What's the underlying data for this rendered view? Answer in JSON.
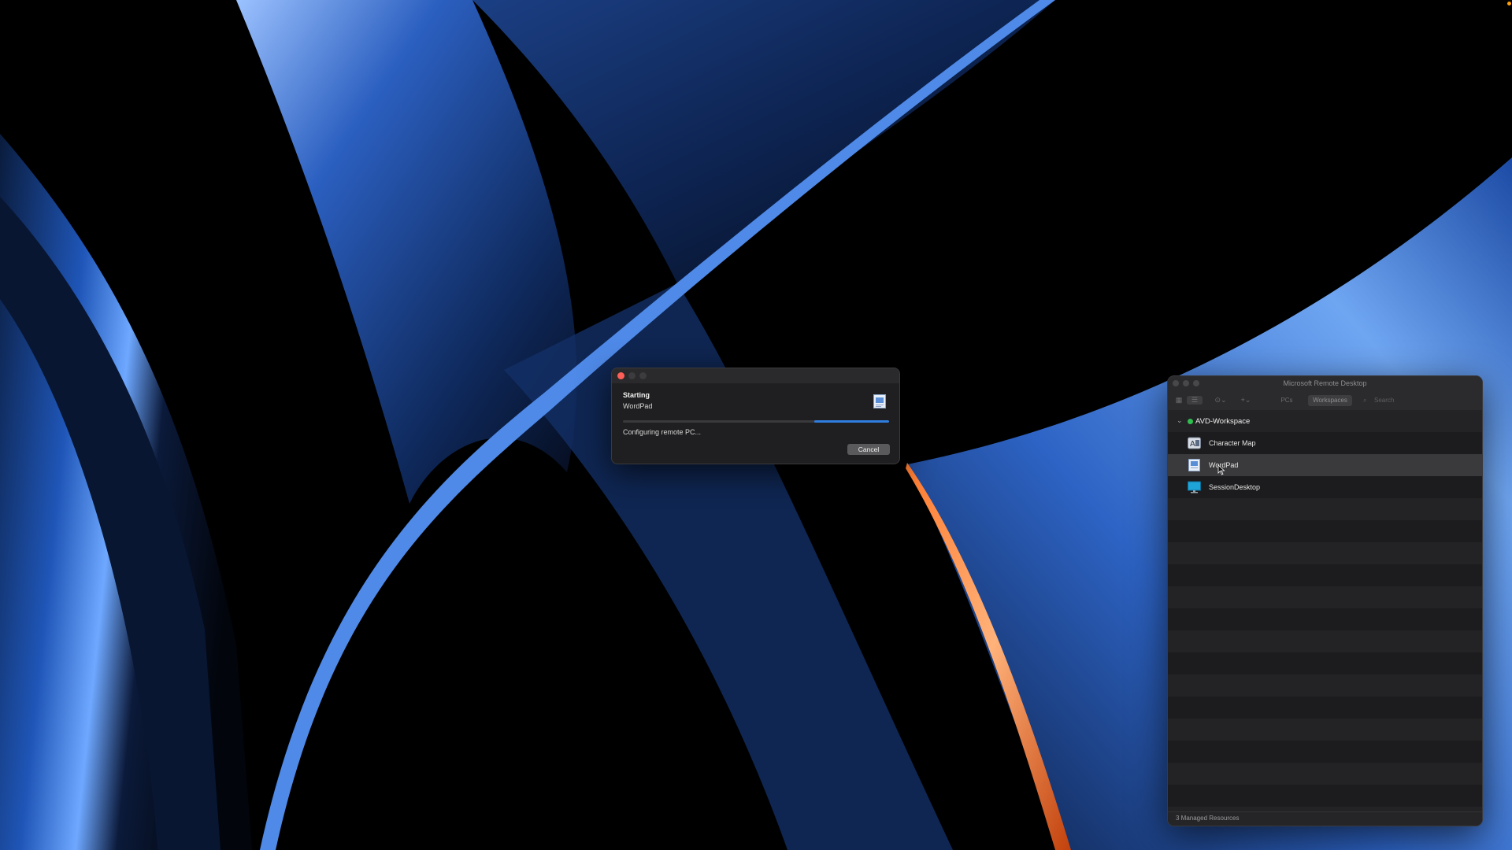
{
  "dialog": {
    "title": "Starting",
    "app_name": "WordPad",
    "status_text": "Configuring remote PC...",
    "cancel_label": "Cancel",
    "progress_percent": 28,
    "accent_color": "#2f7de0"
  },
  "remote_desktop": {
    "window_title": "Microsoft Remote Desktop",
    "toolbar": {
      "tabs": [
        {
          "label": "PCs",
          "selected": false
        },
        {
          "label": "Workspaces",
          "selected": true
        }
      ],
      "search_placeholder": "Search",
      "icons": [
        "grid-view-icon",
        "list-view-icon",
        "more-options-icon",
        "add-icon",
        "search-icon"
      ]
    },
    "workspace": {
      "name": "AVD-Workspace",
      "status_color": "#2fbf4f",
      "resources": [
        {
          "label": "Character Map",
          "icon": "character-map-icon"
        },
        {
          "label": "WordPad",
          "icon": "wordpad-icon",
          "selected": true
        },
        {
          "label": "SessionDesktop",
          "icon": "session-desktop-icon"
        }
      ]
    },
    "footer_text": "3 Managed Resources"
  }
}
